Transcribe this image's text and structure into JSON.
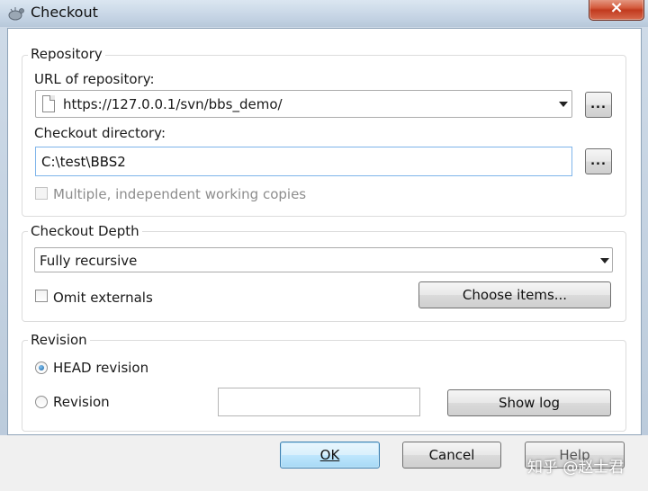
{
  "window": {
    "title": "Checkout",
    "close_glyph": "×"
  },
  "repository": {
    "group_label": "Repository",
    "url_label": "URL of repository:",
    "url_value": "https://127.0.0.1/svn/bbs_demo/",
    "browse_url_label": "...",
    "dir_label": "Checkout directory:",
    "dir_value": "C:\\test\\BBS2",
    "browse_dir_label": "...",
    "multiple_label": "Multiple, independent working copies",
    "multiple_checked": false
  },
  "depth": {
    "group_label": "Checkout Depth",
    "selected": "Fully recursive",
    "omit_label": "Omit externals",
    "omit_checked": false,
    "choose_label": "Choose items..."
  },
  "revision": {
    "group_label": "Revision",
    "head_label": "HEAD revision",
    "rev_label": "Revision",
    "rev_value": "",
    "selected": "head",
    "showlog_label": "Show log"
  },
  "buttons": {
    "ok_label": "OK",
    "cancel_label": "Cancel",
    "help_label": "Help"
  },
  "watermark": {
    "text": "知乎 @赵士君"
  },
  "colors": {
    "focus_border": "#7eb4ea",
    "ok_border": "#3c7fb1",
    "close_red": "#c13a1e"
  }
}
